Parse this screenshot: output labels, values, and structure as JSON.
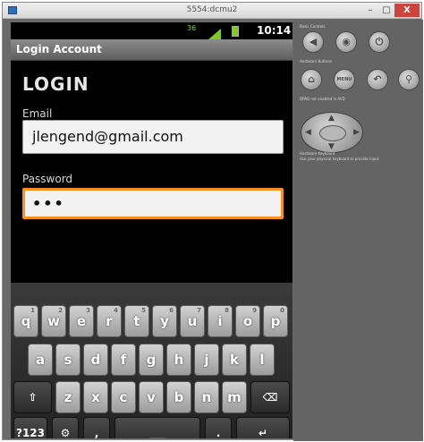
{
  "window": {
    "title": "5554:dcmu2",
    "minimize": "–",
    "maximize": "□",
    "close": "X"
  },
  "status": {
    "time": "10:14",
    "notif_icon": "36"
  },
  "app": {
    "title": "Login Account"
  },
  "form": {
    "heading": "LOGIN",
    "email_label": "Email",
    "email_value": "jlengend@gmail.com",
    "password_label": "Password",
    "password_value": "•••"
  },
  "keyboard": {
    "row1": [
      {
        "k": "q",
        "n": "1"
      },
      {
        "k": "w",
        "n": "2"
      },
      {
        "k": "e",
        "n": "3"
      },
      {
        "k": "r",
        "n": "4"
      },
      {
        "k": "t",
        "n": "5"
      },
      {
        "k": "y",
        "n": "6"
      },
      {
        "k": "u",
        "n": "7"
      },
      {
        "k": "i",
        "n": "8"
      },
      {
        "k": "o",
        "n": "9"
      },
      {
        "k": "p",
        "n": "0"
      }
    ],
    "row2": [
      "a",
      "s",
      "d",
      "f",
      "g",
      "h",
      "j",
      "k",
      "l"
    ],
    "row3": [
      "z",
      "x",
      "c",
      "v",
      "b",
      "n",
      "m"
    ],
    "shift": "⇧",
    "backspace": "⌫",
    "sym": "?123",
    "settings": "⚙",
    "comma": ",",
    "period": ".",
    "space": "___",
    "enter": "↵"
  },
  "panel": {
    "basic_controls": "Basic Controls",
    "hardware_buttons": "Hardware Buttons",
    "dpad_note": "DPAD not enabled in AVD",
    "hardware_keyboard": "Hardware Keyboard",
    "keyboard_note": "Use your physical keyboard to provide input",
    "menu_label": "MENU",
    "icons": [
      "volume-down-icon",
      "volume-up-icon",
      "power-icon",
      "home-icon",
      "menu-icon",
      "back-icon",
      "search-icon"
    ]
  }
}
